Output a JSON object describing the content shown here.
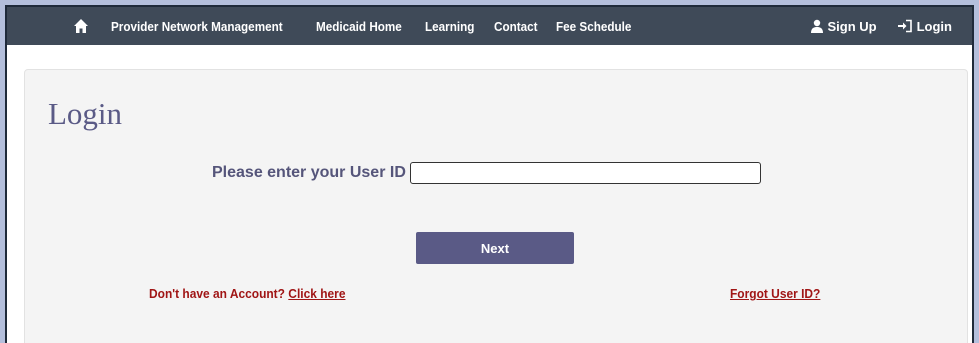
{
  "nav": {
    "links": [
      {
        "label": "Provider Network Management"
      },
      {
        "label": "Medicaid Home"
      },
      {
        "label": "Learning"
      },
      {
        "label": "Contact"
      },
      {
        "label": "Fee Schedule"
      }
    ],
    "signup_label": "Sign Up",
    "login_label": "Login",
    "home_icon": "home-icon",
    "signup_icon": "user-icon",
    "login_icon": "login-icon"
  },
  "main": {
    "title": "Login",
    "userid_label": "Please enter your User ID",
    "userid_value": "",
    "next_label": "Next",
    "no_account_text": "Don't have an Account?",
    "click_here_label": "Click here",
    "forgot_label": "Forgot User ID?"
  },
  "colors": {
    "navbar": "#3f4a58",
    "accent": "#5a5a86",
    "link": "#a01515",
    "outer_background": "#b4bfdc"
  }
}
